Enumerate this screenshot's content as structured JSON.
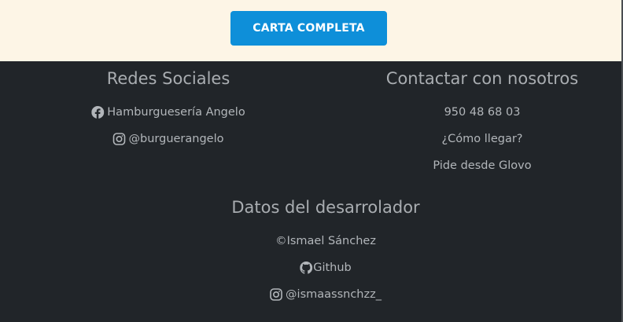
{
  "top": {
    "cta_label": "CARTA COMPLETA"
  },
  "social": {
    "title": "Redes Sociales",
    "facebook": {
      "icon": "facebook-icon",
      "label": "Hamburguesería Angelo"
    },
    "instagram": {
      "icon": "instagram-icon",
      "label": "@burguerangelo"
    }
  },
  "contact": {
    "title": "Contactar con nosotros",
    "phone": "950 48 68 03",
    "directions": "¿Cómo llegar?",
    "glovo": "Pide desde Glovo"
  },
  "developer": {
    "title": "Datos del desarrolador",
    "copyright": "©Ismael Sánchez",
    "github": {
      "icon": "github-icon",
      "label": "Github"
    },
    "instagram": {
      "icon": "instagram-icon",
      "label": "@ismaassnchzz_"
    }
  },
  "colors": {
    "cta_background": "#0e8fd9",
    "top_background": "#fdf5e6",
    "footer_background": "#212529"
  }
}
